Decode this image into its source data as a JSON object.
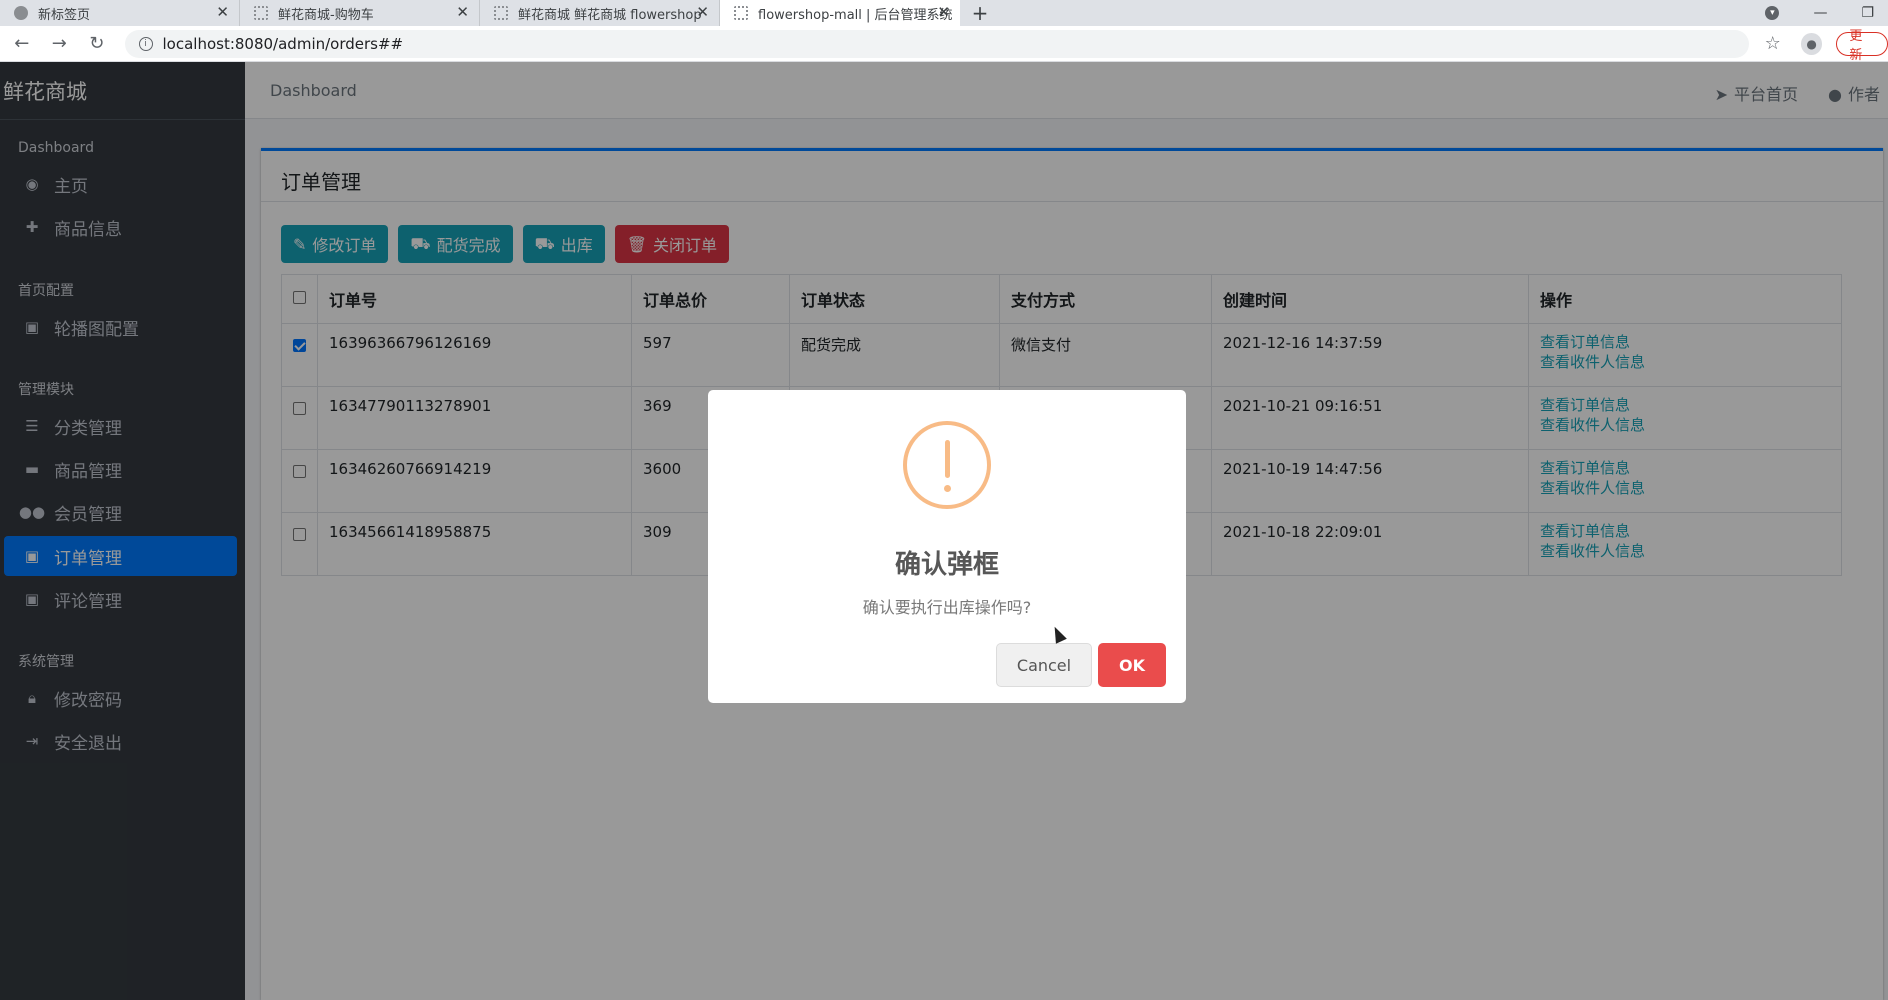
{
  "browser": {
    "tabs": [
      {
        "title": "新标签页",
        "active": false
      },
      {
        "title": "鲜花商城-购物车",
        "active": false
      },
      {
        "title": "鲜花商城 鲜花商城 flowershop",
        "active": false
      },
      {
        "title": "flowershop-mall | 后台管理系统",
        "active": true
      }
    ],
    "new_tab_symbol": "+",
    "url": "localhost:8080/admin/orders##",
    "update_label": "更新"
  },
  "sidebar": {
    "brand": "鲜花商城",
    "sections": [
      {
        "header": "Dashboard",
        "items": [
          {
            "label": "主页",
            "icon": "dashboard-icon",
            "active": false
          },
          {
            "label": "商品信息",
            "icon": "plus-icon",
            "active": false
          }
        ]
      },
      {
        "header": "首页配置",
        "items": [
          {
            "label": "轮播图配置",
            "icon": "image-icon",
            "active": false
          }
        ]
      },
      {
        "header": "管理模块",
        "items": [
          {
            "label": "分类管理",
            "icon": "list-icon",
            "active": false
          },
          {
            "label": "商品管理",
            "icon": "archive-icon",
            "active": false
          },
          {
            "label": "会员管理",
            "icon": "users-icon",
            "active": false
          },
          {
            "label": "订单管理",
            "icon": "money-icon",
            "active": true
          },
          {
            "label": "评论管理",
            "icon": "money-icon",
            "active": false
          }
        ]
      },
      {
        "header": "系统管理",
        "items": [
          {
            "label": "修改密码",
            "icon": "lock-icon",
            "active": false
          },
          {
            "label": "安全退出",
            "icon": "sign-out-icon",
            "active": false
          }
        ]
      }
    ]
  },
  "header": {
    "breadcrumb": "Dashboard",
    "links": [
      {
        "label": "平台首页",
        "icon": "paper-plane-icon"
      },
      {
        "label": "作者",
        "icon": "user-icon"
      }
    ]
  },
  "card": {
    "title": "订单管理",
    "buttons": [
      {
        "label": "修改订单",
        "icon": "edit-icon",
        "style": "info"
      },
      {
        "label": "配货完成",
        "icon": "truck-icon",
        "style": "info"
      },
      {
        "label": "出库",
        "icon": "truck-icon",
        "style": "info"
      },
      {
        "label": "关闭订单",
        "icon": "trash-icon",
        "style": "danger"
      }
    ],
    "table": {
      "columns": [
        "订单号",
        "订单总价",
        "订单状态",
        "支付方式",
        "创建时间",
        "操作"
      ],
      "rows": [
        {
          "checked": true,
          "order_no": "16396366796126169",
          "total": "597",
          "status": "配货完成",
          "payment": "微信支付",
          "created": "2021-12-16 14:37:59"
        },
        {
          "checked": false,
          "order_no": "16347790113278901",
          "total": "369",
          "status": "",
          "payment": "",
          "created": "2021-10-21 09:16:51"
        },
        {
          "checked": false,
          "order_no": "16346260766914219",
          "total": "3600",
          "status": "",
          "payment": "",
          "created": "2021-10-19 14:47:56"
        },
        {
          "checked": false,
          "order_no": "16345661418958875",
          "total": "309",
          "status": "",
          "payment": "",
          "created": "2021-10-18 22:09:01"
        }
      ],
      "action_links": [
        "查看订单信息",
        "查看收件人信息"
      ]
    }
  },
  "modal": {
    "title": "确认弹框",
    "text": "确认要执行出库操作吗?",
    "cancel_label": "Cancel",
    "ok_label": "OK"
  },
  "colors": {
    "sidebar_bg": "#343a40",
    "primary": "#007bff",
    "info": "#17a2b8",
    "danger": "#dc3545",
    "warning_icon": "#f8bb86",
    "ok_button": "#ea4c4c"
  }
}
